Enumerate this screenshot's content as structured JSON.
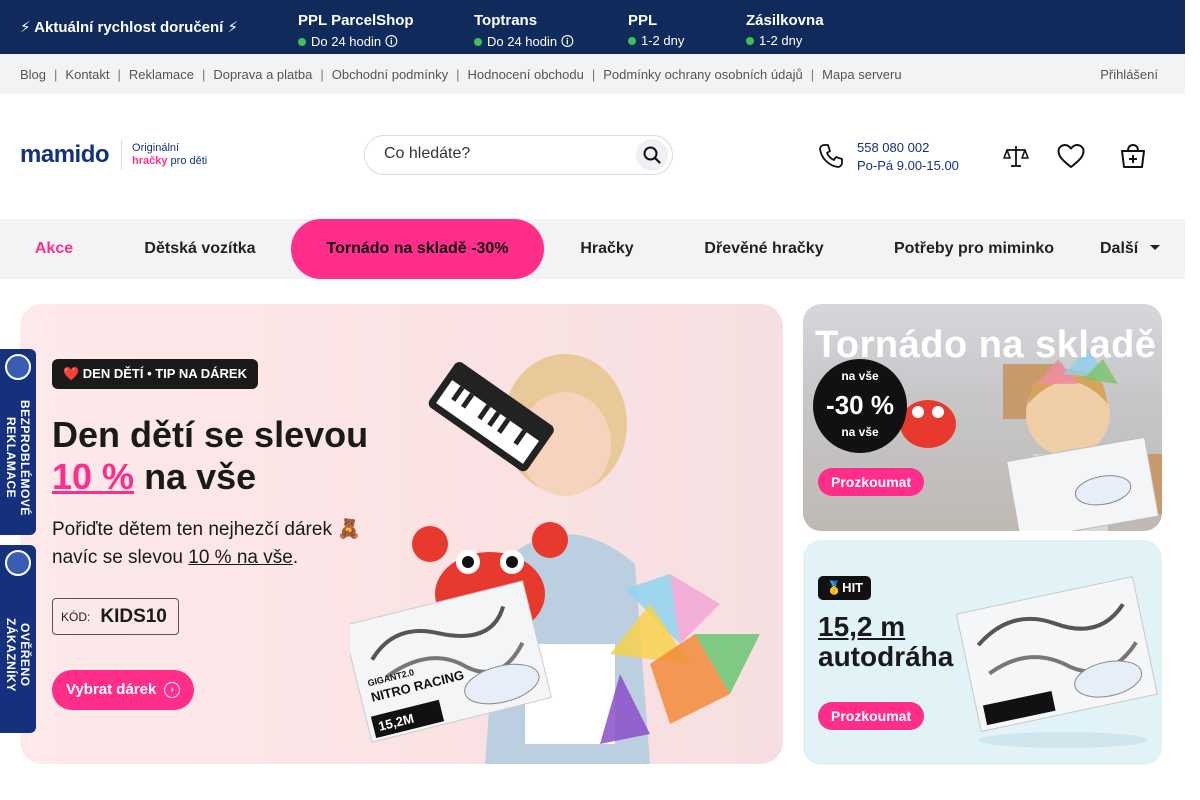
{
  "delivery": {
    "title": "⚡ Aktuální rychlost doručení ⚡",
    "carriers": [
      {
        "name": "PPL ParcelShop",
        "time": "Do 24 hodin 🛈"
      },
      {
        "name": "Toptrans",
        "time": "Do 24 hodin 🛈"
      },
      {
        "name": "PPL",
        "time": "1-2 dny"
      },
      {
        "name": "Zásilkovna",
        "time": "1-2 dny"
      }
    ],
    "status_color": "#3fbf5a"
  },
  "links": {
    "items": [
      "Blog",
      "Kontakt",
      "Reklamace",
      "Doprava a platba",
      "Obchodní podmínky",
      "Hodnocení obchodu",
      "Podmínky ochrany osobních údajů",
      "Mapa serveru"
    ],
    "separator": "|",
    "login": "Přihlášení"
  },
  "header": {
    "logo_text": "mamido",
    "logo_tag_line1": "Originální",
    "logo_tag_line2_pink": "hračky",
    "logo_tag_line2_rest": " pro děti",
    "search_placeholder": "Co hledáte?",
    "phone": "558 080 002",
    "hours": "Po-Pá 9.00-15.00",
    "icons": [
      "search-icon",
      "phone-icon",
      "compare-icon",
      "heart-icon",
      "cart-icon"
    ]
  },
  "nav": {
    "items": [
      "Akce",
      "Dětská vozítka",
      "Tornádo na skladě -30%",
      "Hračky",
      "Dřevěné hračky",
      "Potřeby pro miminko",
      "Další"
    ]
  },
  "hero": {
    "badge": "❤️ DEN DĚTÍ • TIP NA DÁREK",
    "title_line1": "Den dětí se slevou",
    "title_pink": "10 %",
    "title_rest": " na vše",
    "desc_line1": "Pořiďte dětem ten nejhezčí dárek 🧸",
    "desc_line2_pre": "navíc se slevou ",
    "desc_line2_u": "10 % na vše",
    "desc_line2_post": ".",
    "code_label": "KÓD:",
    "code": "KIDS10",
    "cta": "Vybrat dárek",
    "product_text1": "GIGANT2.0",
    "product_text2": "NITRO RACING",
    "product_text3": "15,2M"
  },
  "side_banner_1": {
    "title": "Tornádo na skladě",
    "disc_top": "na vše",
    "disc_value": "-30 %",
    "disc_bottom": "na vše",
    "cta": "Prozkoumat"
  },
  "side_banner_2": {
    "hit": "🥇HIT",
    "title_u": "15,2 m",
    "title_line2": "autodráha",
    "cta": "Prozkoumat"
  },
  "side_badges": {
    "reklamace": "BEZPROBLÉMOVÉ REKLAMACE",
    "overeno": "OVĚŘENO ZÁKAZNÍKY"
  },
  "colors": {
    "navy": "#0f2a5b",
    "brand_blue": "#15317e",
    "pink": "#ff2e8a"
  }
}
